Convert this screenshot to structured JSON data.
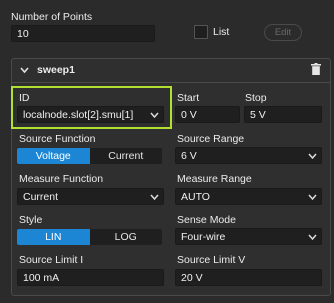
{
  "num_points": {
    "label": "Number of Points",
    "value": "10"
  },
  "list": {
    "label": "List",
    "checked": false
  },
  "edit_button": {
    "label": "Edit"
  },
  "sweep": {
    "title": "sweep1",
    "id": {
      "label": "ID",
      "value": "localnode.slot[2].smu[1]"
    },
    "start": {
      "label": "Start",
      "value": "0 V"
    },
    "stop": {
      "label": "Stop",
      "value": "5 V"
    },
    "source_function": {
      "label": "Source Function",
      "options": [
        "Voltage",
        "Current"
      ],
      "selected": "Voltage"
    },
    "source_range": {
      "label": "Source Range",
      "value": "6 V"
    },
    "measure_function": {
      "label": "Measure Function",
      "value": "Current"
    },
    "measure_range": {
      "label": "Measure Range",
      "value": "AUTO"
    },
    "style": {
      "label": "Style",
      "options": [
        "LIN",
        "LOG"
      ],
      "selected": "LIN"
    },
    "sense_mode": {
      "label": "Sense Mode",
      "value": "Four-wire"
    },
    "source_limit_i": {
      "label": "Source Limit I",
      "value": "100 mA"
    },
    "source_limit_v": {
      "label": "Source Limit V",
      "value": "20 V"
    }
  },
  "colors": {
    "accent": "#1c86d4",
    "highlight": "#b2e030",
    "background": "#2b2b2b",
    "field": "#1f1f1f"
  },
  "icons": {
    "collapse": "chevron-down-icon",
    "delete": "trash-icon",
    "select": "chevron-down-icon"
  }
}
